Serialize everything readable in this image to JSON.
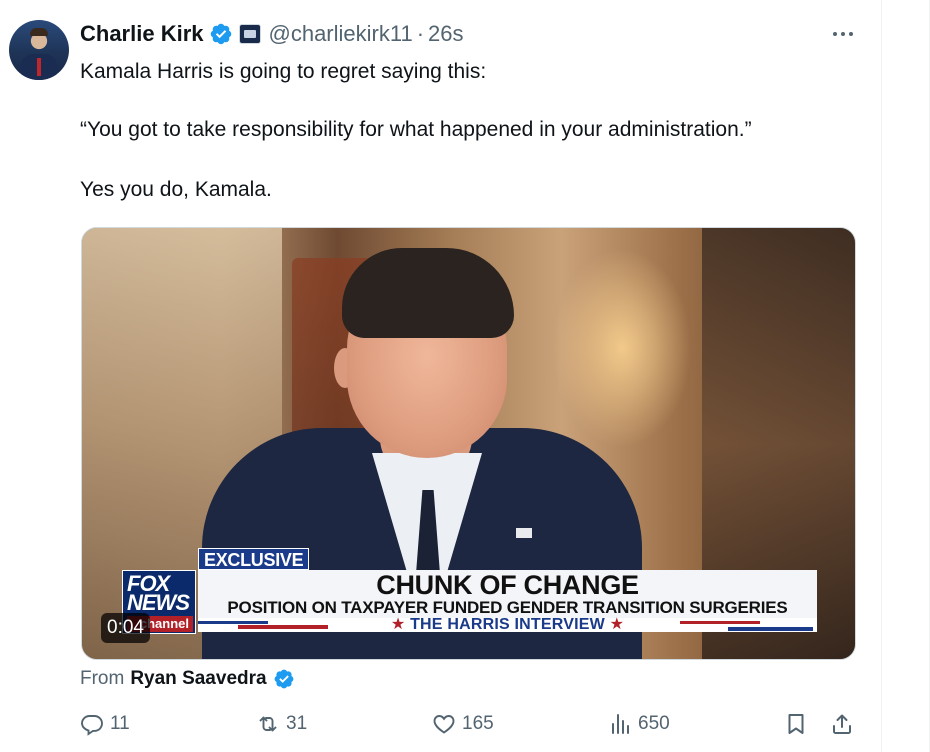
{
  "tweet": {
    "author_name": "Charlie Kirk",
    "handle": "@charliekirk11",
    "separator": "·",
    "time": "26s",
    "text_line1": "Kamala Harris is going to regret saying this:",
    "text_line2": "“You got to take responsibility for what happened in your administration.”",
    "text_line3": "Yes you do, Kamala."
  },
  "video": {
    "duration": "0:04",
    "exclusive_label": "EXCLUSIVE",
    "headline": "CHUNK OF CHANGE",
    "subheadline": "POSITION ON TAXPAYER FUNDED GENDER TRANSITION SURGERIES",
    "ticker": "THE HARRIS INTERVIEW",
    "star": "★",
    "logo_line1": "FOX",
    "logo_line2": "NEWS",
    "logo_line3": "channel"
  },
  "attribution": {
    "prefix": "From",
    "source_name": "Ryan Saavedra"
  },
  "actions": {
    "replies": "11",
    "reposts": "31",
    "likes": "165",
    "views": "650"
  },
  "colors": {
    "verified_blue": "#1d9bf0",
    "muted_text": "#536471",
    "fox_blue": "#0b2a6b",
    "fox_red": "#b22028"
  },
  "icons": [
    "verified-badge-icon",
    "affiliation-badge-icon",
    "more-icon",
    "reply-icon",
    "repost-icon",
    "like-icon",
    "views-icon",
    "bookmark-icon",
    "share-icon"
  ]
}
